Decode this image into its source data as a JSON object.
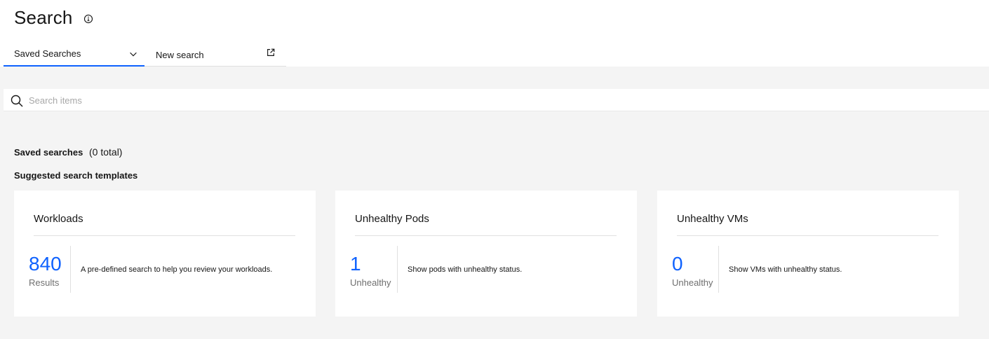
{
  "header": {
    "title": "Search",
    "info_icon": "info-icon"
  },
  "tabs": [
    {
      "label": "Saved Searches",
      "icon": "chevron-down-icon",
      "selected": true
    },
    {
      "label": "New search",
      "icon": "launch-icon",
      "selected": false
    }
  ],
  "search": {
    "placeholder": "Search items",
    "value": "",
    "icon": "search-icon"
  },
  "saved": {
    "heading": "Saved searches",
    "count": "(0 total)"
  },
  "suggested": {
    "heading": "Suggested search templates",
    "cards": [
      {
        "title": "Workloads",
        "count": "840",
        "unit": "Results",
        "description": "A pre-defined search to help you review your workloads."
      },
      {
        "title": "Unhealthy Pods",
        "count": "1",
        "unit": "Unhealthy",
        "description": "Show pods with unhealthy status."
      },
      {
        "title": "Unhealthy VMs",
        "count": "0",
        "unit": "Unhealthy",
        "description": "Show VMs with unhealthy status."
      }
    ]
  },
  "colors": {
    "accent": "#0f62fe",
    "background": "#f4f4f4",
    "surface": "#ffffff",
    "text": "#161616",
    "muted": "#6f6f6f"
  }
}
